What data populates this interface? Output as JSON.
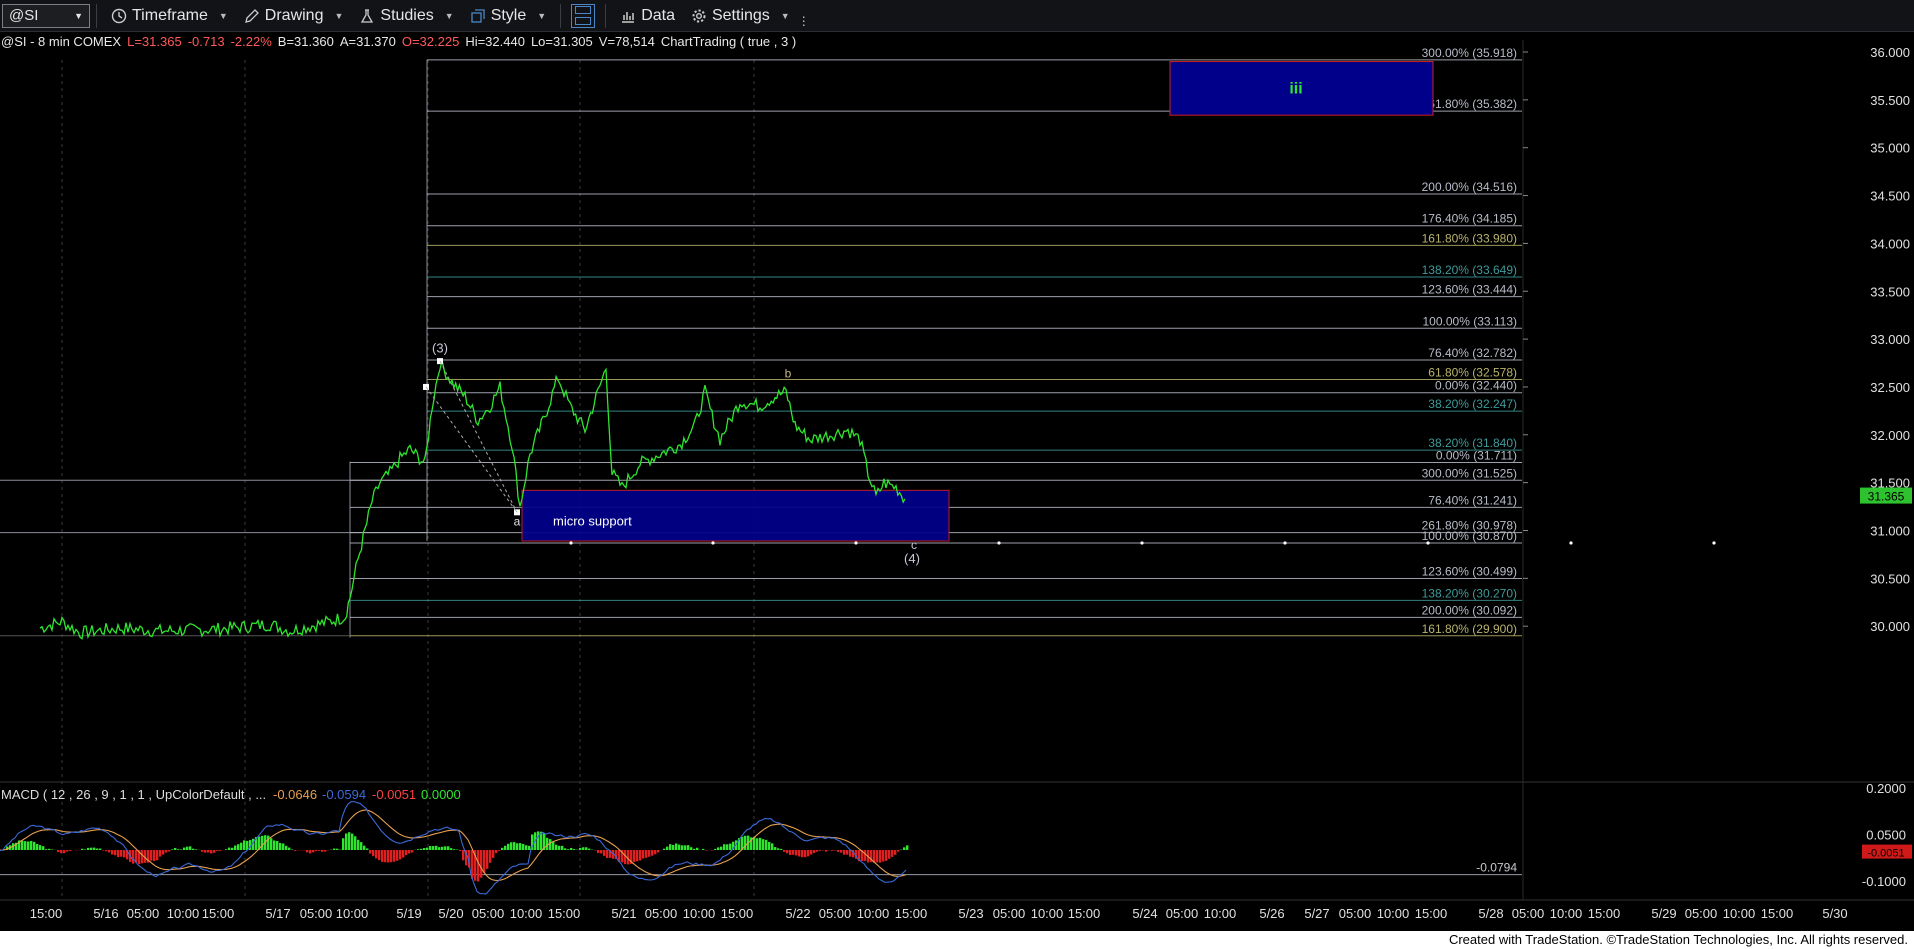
{
  "toolbar": {
    "symbol": "@SI",
    "items": [
      {
        "id": "timeframe",
        "label": "Timeframe",
        "icon": "clock-icon"
      },
      {
        "id": "drawing",
        "label": "Drawing",
        "icon": "pencil-icon"
      },
      {
        "id": "studies",
        "label": "Studies",
        "icon": "flask-icon"
      },
      {
        "id": "style",
        "label": "Style",
        "icon": "style-icon"
      },
      {
        "id": "data",
        "label": "Data",
        "icon": "bar-chart-icon"
      },
      {
        "id": "settings",
        "label": "Settings",
        "icon": "gear-icon"
      }
    ]
  },
  "info": {
    "symbol": "@SI - 8 min  COMEX",
    "last": "L=31.365",
    "change": "-0.713",
    "change_pct": "-2.22%",
    "bid": "B=31.360",
    "ask": "A=31.370",
    "open": "O=32.225",
    "high": "Hi=32.440",
    "low": "Lo=31.305",
    "volume": "V=78,514",
    "study": "ChartTrading ( true , 3 )"
  },
  "macd": {
    "label": "MACD ( 12 , 26 , 9 , 1 , 1 , UpColorDefault , ...",
    "v1": "-0.0646",
    "v2": "-0.0594",
    "v3": "-0.0051",
    "v4": "0.0000",
    "axis": [
      "0.2000",
      "0.0500",
      "-0.1000"
    ],
    "hist_value": "-0.0051",
    "line_value": "-0.0794"
  },
  "price_axis": [
    "36.000",
    "35.500",
    "35.000",
    "34.500",
    "34.000",
    "33.500",
    "33.000",
    "32.500",
    "32.000",
    "31.500",
    "31.000",
    "30.500",
    "30.000"
  ],
  "last_price": "31.365",
  "fib_levels": [
    {
      "text": "300.00% (35.918)",
      "price": 35.918,
      "color": "#b8bcc8"
    },
    {
      "text": "261.80% (35.382)",
      "price": 35.382,
      "color": "#b8bcc8"
    },
    {
      "text": "200.00% (34.516)",
      "price": 34.516,
      "color": "#b8bcc8"
    },
    {
      "text": "176.40% (34.185)",
      "price": 34.185,
      "color": "#b8bcc8"
    },
    {
      "text": "161.80% (33.980)",
      "price": 33.98,
      "color": "#b9b36a"
    },
    {
      "text": "138.20% (33.649)",
      "price": 33.649,
      "color": "#3e9a9a"
    },
    {
      "text": "123.60% (33.444)",
      "price": 33.444,
      "color": "#b8bcc8"
    },
    {
      "text": "100.00% (33.113)",
      "price": 33.113,
      "color": "#b8bcc8"
    },
    {
      "text": "76.40% (32.782)",
      "price": 32.782,
      "color": "#b8bcc8"
    },
    {
      "text": "61.80% (32.578)",
      "price": 32.578,
      "color": "#b9b36a"
    },
    {
      "text": "0.00% (32.440)",
      "price": 32.44,
      "color": "#b8bcc8"
    },
    {
      "text": "38.20% (32.247)",
      "price": 32.247,
      "color": "#3e9a9a"
    },
    {
      "text": "38.20% (31.840)",
      "price": 31.84,
      "color": "#3e9a9a"
    },
    {
      "text": "0.00% (31.711)",
      "price": 31.711,
      "color": "#b8bcc8"
    },
    {
      "text": "300.00% (31.525)",
      "price": 31.525,
      "color": "#b8bcc8"
    },
    {
      "text": "76.40% (31.241)",
      "price": 31.241,
      "color": "#b8bcc8"
    },
    {
      "text": "261.80% (30.978)",
      "price": 30.978,
      "color": "#b8bcc8"
    },
    {
      "text": "100.00% (30.870)",
      "price": 30.87,
      "color": "#b8bcc8"
    },
    {
      "text": "123.60% (30.499)",
      "price": 30.499,
      "color": "#b8bcc8"
    },
    {
      "text": "138.20% (30.270)",
      "price": 30.27,
      "color": "#3e9a9a"
    },
    {
      "text": "200.00% (30.092)",
      "price": 30.092,
      "color": "#b8bcc8"
    },
    {
      "text": "161.80% (29.900)",
      "price": 29.9,
      "color": "#b9b36a"
    }
  ],
  "wave_labels": [
    "(3)",
    "a",
    "b",
    "c",
    "(4)",
    "iii"
  ],
  "zones": [
    {
      "label": "micro support",
      "top": 31.42,
      "bottom": 30.89
    },
    {
      "label": "iii",
      "top": 35.9,
      "bottom": 35.34
    }
  ],
  "time_axis": [
    "15:00",
    "5/16",
    "05:00",
    "10:00",
    "15:00",
    "5/17",
    "05:00",
    "10:00",
    "5/19",
    "5/20",
    "05:00",
    "10:00",
    "15:00",
    "5/21",
    "05:00",
    "10:00",
    "15:00",
    "5/22",
    "05:00",
    "10:00",
    "15:00",
    "5/23",
    "05:00",
    "10:00",
    "15:00",
    "5/24",
    "05:00",
    "10:00",
    "5/26",
    "5/27",
    "05:00",
    "10:00",
    "15:00",
    "5/28",
    "05:00",
    "10:00",
    "15:00",
    "5/29",
    "05:00",
    "10:00",
    "15:00",
    "5/30"
  ],
  "footer": "Created with TradeStation. ©TradeStation Technologies, Inc. All rights reserved.",
  "colors": {
    "price": "#2ee62e",
    "fib_gray": "#b8bcc8",
    "fib_teal": "#3e9a9a",
    "fib_olive": "#b9b36a",
    "zone_fill": "#00008b",
    "zone_border": "#d02020",
    "down": "#e02020",
    "macd_fast": "#3a6ad8",
    "macd_slow": "#e6a050"
  },
  "chart_data": {
    "type": "line",
    "symbol": "@SI",
    "interval": "8 min",
    "y_axis_range": [
      29.85,
      36.1
    ],
    "price_path_approx": [
      {
        "time": "5/15 14:00",
        "price": 30.0
      },
      {
        "time": "5/16 00:00",
        "price": 29.98
      },
      {
        "time": "5/17 10:00",
        "price": 30.05
      },
      {
        "time": "5/17 20:00",
        "price": 31.2
      },
      {
        "time": "5/19 15:00",
        "price": 31.65
      },
      {
        "time": "5/19 21:00",
        "price": 32.75
      },
      {
        "time": "5/20 10:00",
        "price": 31.25
      },
      {
        "time": "5/20 14:00",
        "price": 32.5
      },
      {
        "time": "5/20 20:00",
        "price": 32.65
      },
      {
        "time": "5/21 00:00",
        "price": 31.35
      },
      {
        "time": "5/21 11:00",
        "price": 32.5
      },
      {
        "time": "5/21 20:00",
        "price": 32.25
      },
      {
        "time": "5/22 00:00",
        "price": 32.4
      },
      {
        "time": "5/22 06:00",
        "price": 31.95
      },
      {
        "time": "5/22 11:00",
        "price": 31.3
      },
      {
        "time": "5/22 15:00",
        "price": 31.365
      }
    ]
  }
}
